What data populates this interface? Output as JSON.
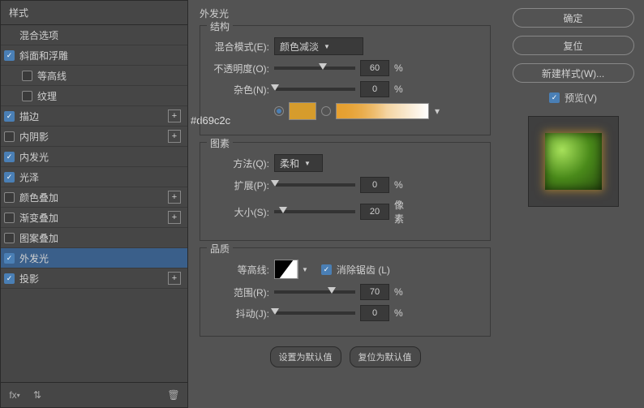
{
  "sidebar": {
    "header": "样式",
    "blend_options": "混合选项",
    "items": [
      {
        "label": "斜面和浮雕",
        "checked": true,
        "plus": false,
        "indent": false
      },
      {
        "label": "等高线",
        "checked": false,
        "plus": false,
        "indent": true
      },
      {
        "label": "纹理",
        "checked": false,
        "plus": false,
        "indent": true
      },
      {
        "label": "描边",
        "checked": true,
        "plus": true,
        "indent": false
      },
      {
        "label": "内阴影",
        "checked": false,
        "plus": true,
        "indent": false
      },
      {
        "label": "内发光",
        "checked": true,
        "plus": false,
        "indent": false
      },
      {
        "label": "光泽",
        "checked": true,
        "plus": false,
        "indent": false
      },
      {
        "label": "颜色叠加",
        "checked": false,
        "plus": true,
        "indent": false
      },
      {
        "label": "渐变叠加",
        "checked": false,
        "plus": true,
        "indent": false
      },
      {
        "label": "图案叠加",
        "checked": false,
        "plus": false,
        "indent": false
      },
      {
        "label": "外发光",
        "checked": true,
        "plus": false,
        "indent": false,
        "selected": true
      },
      {
        "label": "投影",
        "checked": true,
        "plus": true,
        "indent": false
      }
    ]
  },
  "main_title": "外发光",
  "structure": {
    "title": "结构",
    "blend_mode_label": "混合模式(E):",
    "blend_mode_value": "颜色减淡",
    "opacity_label": "不透明度(O):",
    "opacity_value": "60",
    "opacity_unit": "%",
    "noise_label": "杂色(N):",
    "noise_value": "0",
    "noise_unit": "%"
  },
  "color_hex": "#d69c2c",
  "elements": {
    "title": "图素",
    "method_label": "方法(Q):",
    "method_value": "柔和",
    "spread_label": "扩展(P):",
    "spread_value": "0",
    "spread_unit": "%",
    "size_label": "大小(S):",
    "size_value": "20",
    "size_unit": "像素"
  },
  "quality": {
    "title": "品质",
    "contour_label": "等高线:",
    "anti_alias": "消除锯齿 (L)",
    "anti_alias_checked": true,
    "range_label": "范围(R):",
    "range_value": "70",
    "range_unit": "%",
    "jitter_label": "抖动(J):",
    "jitter_value": "0",
    "jitter_unit": "%"
  },
  "buttons": {
    "make_default": "设置为默认值",
    "reset_default": "复位为默认值"
  },
  "right": {
    "ok": "确定",
    "cancel": "复位",
    "new_style": "新建样式(W)...",
    "preview": "预览(V)"
  }
}
